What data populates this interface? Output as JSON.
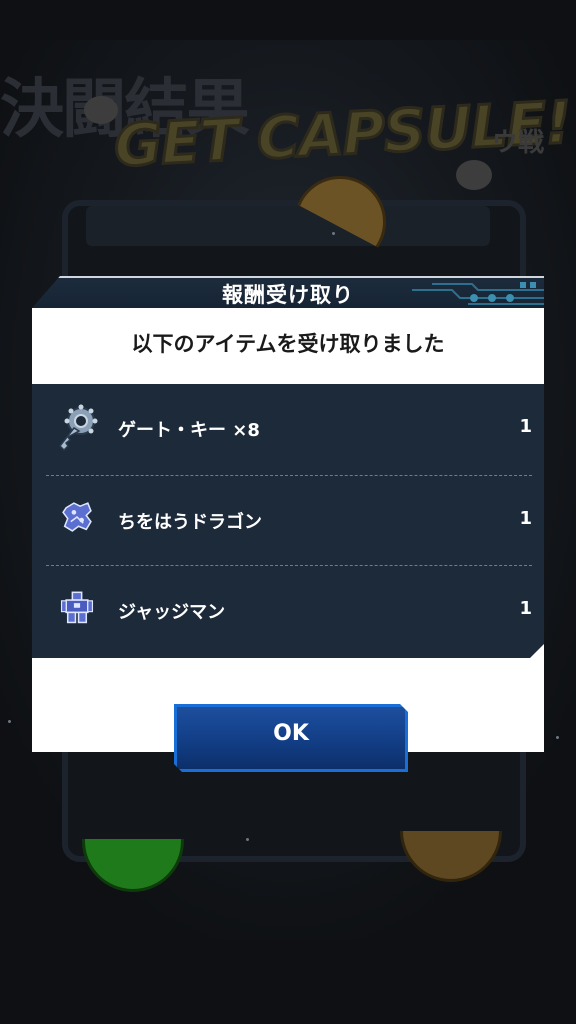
{
  "background": {
    "title_jp": "決闘結果",
    "title_en": "GET CAPSULE!",
    "side_text": "ウ戦"
  },
  "dialog": {
    "title": "報酬受け取り",
    "message": "以下のアイテムを受け取りました",
    "items": [
      {
        "name": "ゲート・キー ×8",
        "qty": "1",
        "icon": "gate-key-icon"
      },
      {
        "name": "ちをはうドラゴン",
        "qty": "1",
        "icon": "dragon-sprite-icon"
      },
      {
        "name": "ジャッジマン",
        "qty": "1",
        "icon": "judgeman-sprite-icon"
      }
    ],
    "ok_label": "OK"
  },
  "colors": {
    "header_bg": "#1d2c3d",
    "panel_bg": "#1d2a3a",
    "button_blue": "#123e86",
    "button_border": "#1a6fd6"
  }
}
